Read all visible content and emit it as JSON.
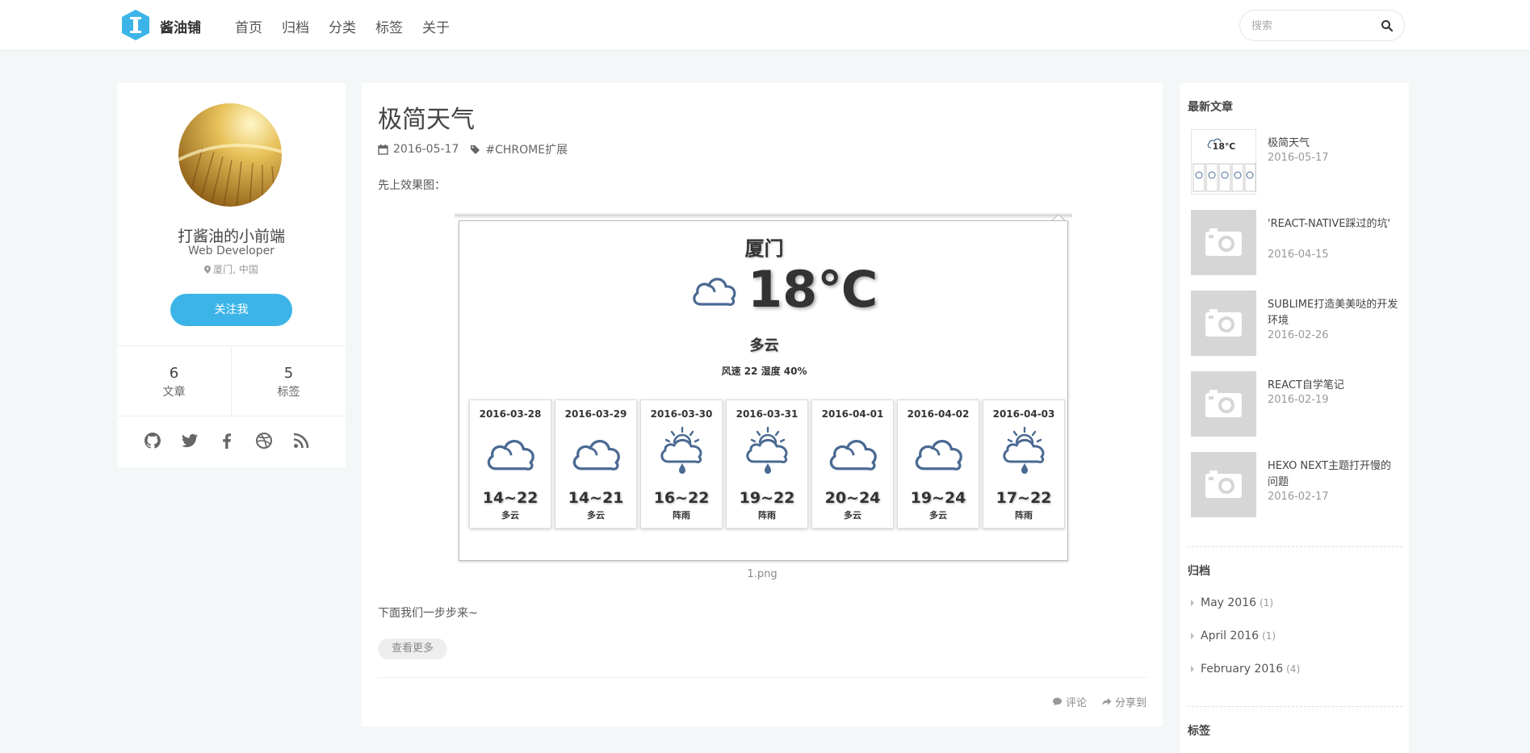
{
  "header": {
    "logo_text": "酱油铺",
    "nav": [
      "首页",
      "归档",
      "分类",
      "标签",
      "关于"
    ],
    "search_placeholder": "搜索"
  },
  "profile": {
    "name": "打酱油的小前端",
    "role": "Web Developer",
    "location": "厦门, 中国",
    "follow_label": "关注我",
    "stats": [
      {
        "num": "6",
        "label": "文章"
      },
      {
        "num": "5",
        "label": "标签"
      }
    ],
    "social_icons": [
      "github-icon",
      "twitter-icon",
      "facebook-icon",
      "dribbble-icon",
      "rss-icon"
    ]
  },
  "article": {
    "title": "极简天气",
    "date": "2016-05-17",
    "tag": "#CHROME扩展",
    "intro": "先上效果图：",
    "caption": "1.png",
    "next_text": "下面我们一步步来~",
    "more_label": "查看更多",
    "comment_label": "评论",
    "share_label": "分享到"
  },
  "weather": {
    "city": "厦门",
    "temp": "18℃",
    "condition": "多云",
    "wind": "风速 22 湿度 40%",
    "days": [
      {
        "date": "2016-03-28",
        "range": "14~22",
        "cond": "多云",
        "icon": "cloudy"
      },
      {
        "date": "2016-03-29",
        "range": "14~21",
        "cond": "多云",
        "icon": "cloudy"
      },
      {
        "date": "2016-03-30",
        "range": "16~22",
        "cond": "阵雨",
        "icon": "shower"
      },
      {
        "date": "2016-03-31",
        "range": "19~22",
        "cond": "阵雨",
        "icon": "shower"
      },
      {
        "date": "2016-04-01",
        "range": "20~24",
        "cond": "多云",
        "icon": "cloudy"
      },
      {
        "date": "2016-04-02",
        "range": "19~24",
        "cond": "多云",
        "icon": "cloudy"
      },
      {
        "date": "2016-04-03",
        "range": "17~22",
        "cond": "阵雨",
        "icon": "shower"
      }
    ]
  },
  "sidebar": {
    "recent_title": "最新文章",
    "posts": [
      {
        "title": "极简天气",
        "date": "2016-05-17"
      },
      {
        "title": "'REACT-NATIVE踩过的坑'",
        "date": "2016-04-15"
      },
      {
        "title": "SUBLIME打造美美哒的开发环境",
        "date": "2016-02-26"
      },
      {
        "title": "REACT自学笔记",
        "date": "2016-02-19"
      },
      {
        "title": "HEXO NEXT主题打开慢的问题",
        "date": "2016-02-17"
      }
    ],
    "archive_title": "归档",
    "archives": [
      {
        "label": "May 2016",
        "count": "(1)"
      },
      {
        "label": "April 2016",
        "count": "(1)"
      },
      {
        "label": "February 2016",
        "count": "(4)"
      }
    ],
    "tags_title": "标签"
  },
  "colors": {
    "accent": "#3cb4e8",
    "icon_blue": "#4a6a93"
  }
}
